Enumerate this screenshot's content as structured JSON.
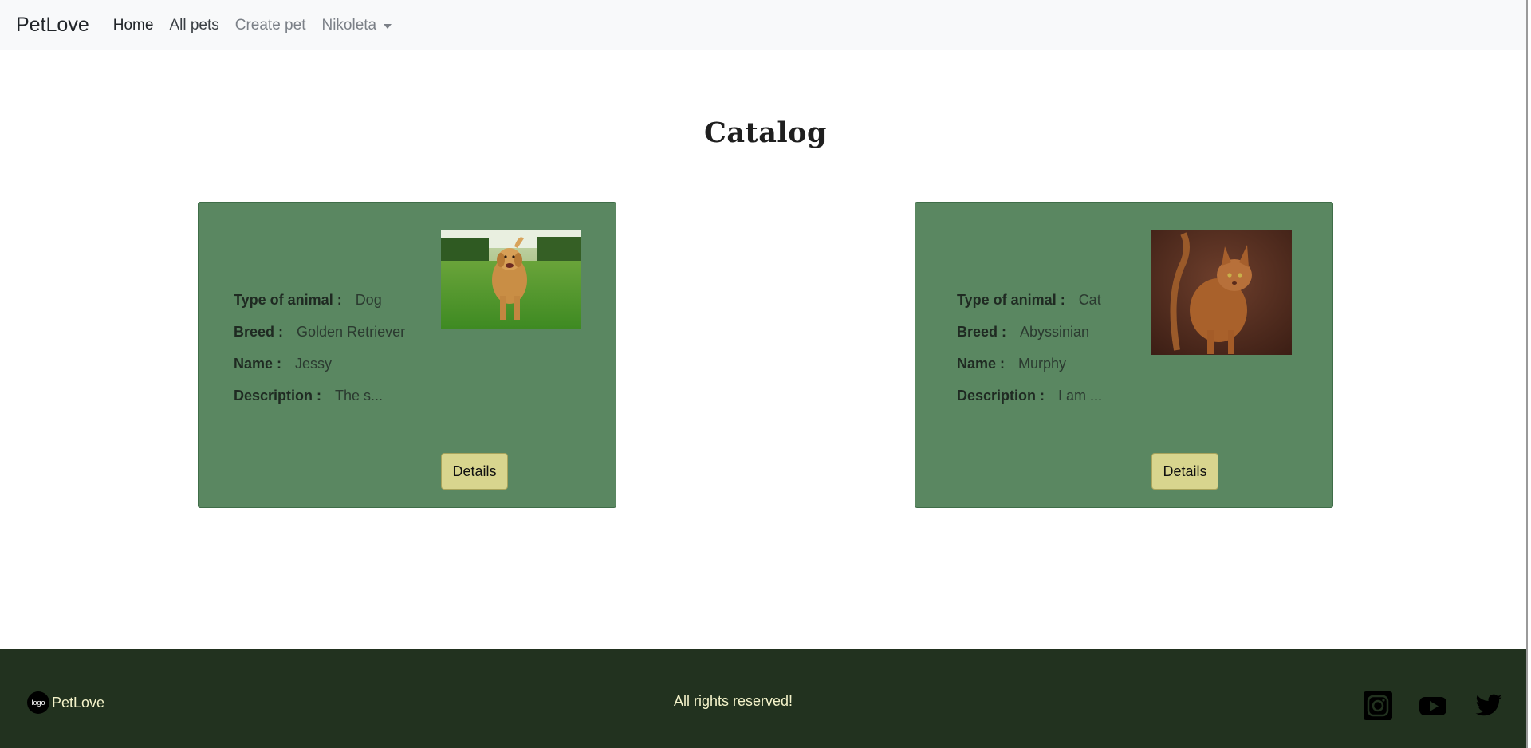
{
  "navbar": {
    "brand": "PetLove",
    "links": [
      {
        "label": "Home"
      },
      {
        "label": "All pets"
      },
      {
        "label": "Create pet"
      },
      {
        "label": "Nikoleta"
      }
    ]
  },
  "page": {
    "title": "Catalog"
  },
  "cards": [
    {
      "type_label": "Type of animal :",
      "type_value": "Dog",
      "breed_label": "Breed :",
      "breed_value": "Golden Retriever",
      "name_label": "Name :",
      "name_value": "Jessy",
      "desc_label": "Description :",
      "desc_value": "The s...",
      "button": "Details"
    },
    {
      "type_label": "Type of animal :",
      "type_value": "Cat",
      "breed_label": "Breed :",
      "breed_value": "Abyssinian",
      "name_label": "Name :",
      "name_value": "Murphy",
      "desc_label": "Description :",
      "desc_value": "I am ...",
      "button": "Details"
    }
  ],
  "footer": {
    "logo_text": "logo",
    "brand": "PetLove",
    "rights": "All rights reserved!",
    "social": [
      "instagram-icon",
      "youtube-icon",
      "twitter-icon"
    ]
  },
  "colors": {
    "card_bg": "#5a8761",
    "button_bg": "#d8d58e",
    "footer_bg": "#22321f",
    "navbar_bg": "#f8f9fa"
  }
}
